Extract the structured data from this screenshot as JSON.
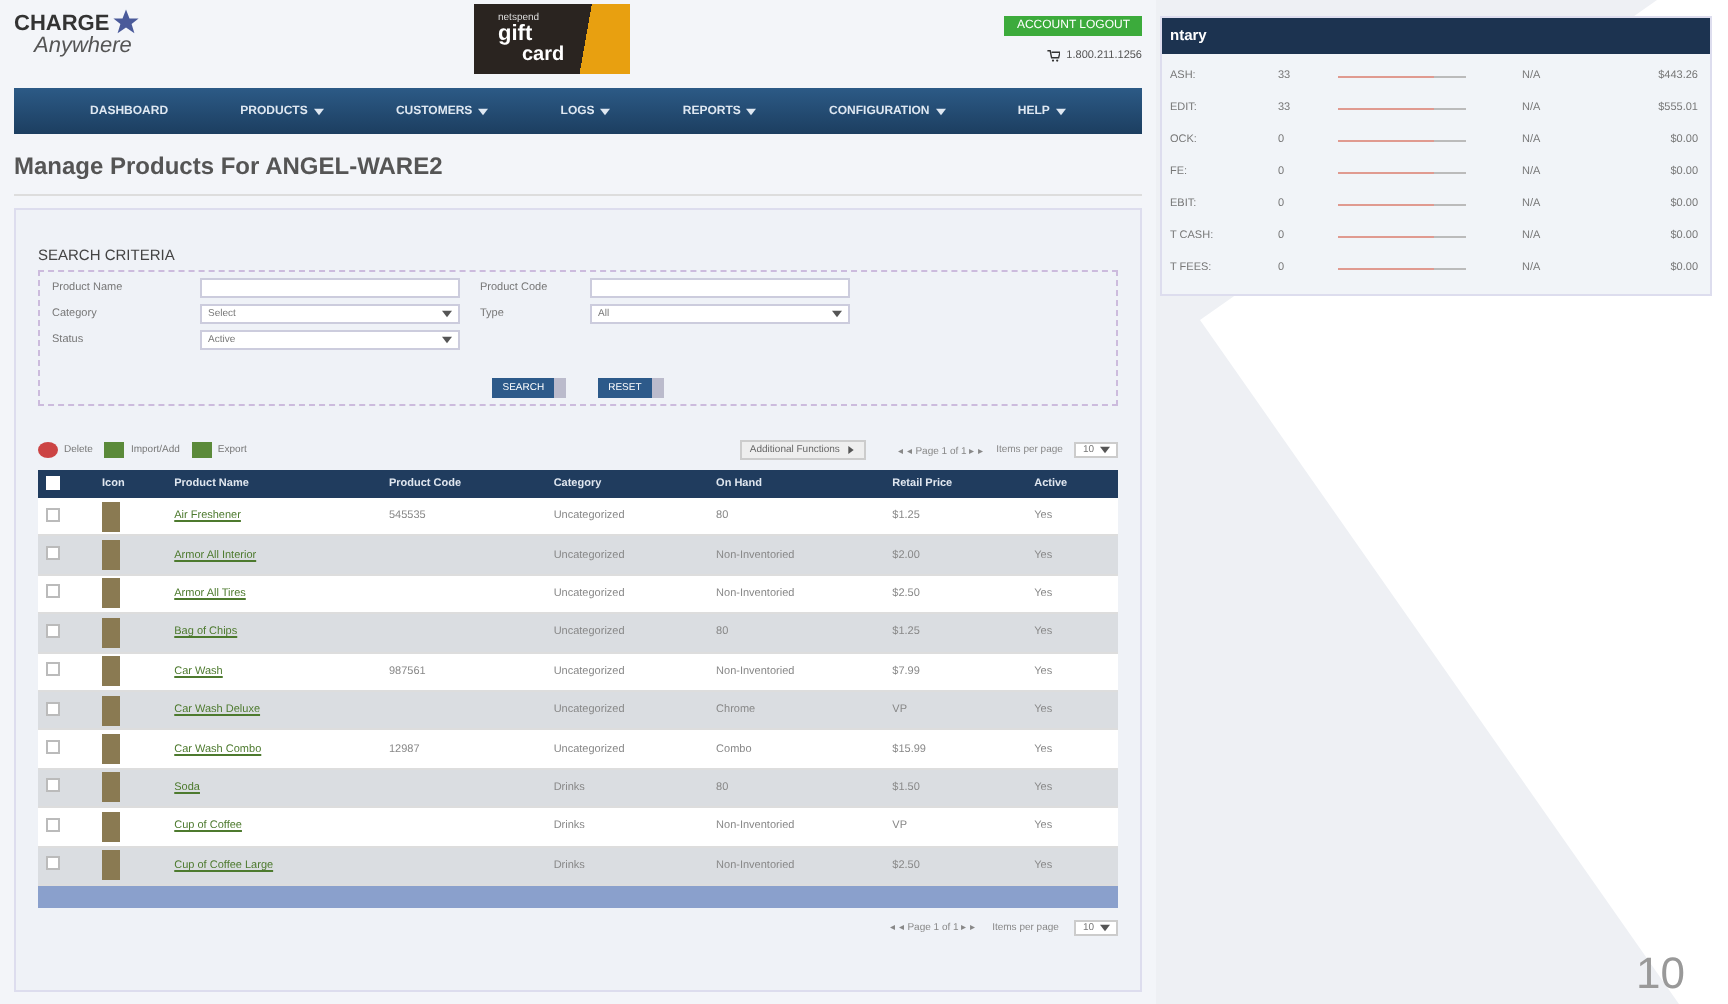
{
  "header": {
    "logo_top": "CHARGE",
    "logo_bottom": "Anywhere",
    "banner_small": "netspend",
    "banner_top": "gift",
    "banner_bottom": "card",
    "logout_button": "ACCOUNT LOGOUT",
    "phone": "1.800.211.1256"
  },
  "nav": [
    {
      "label": "DASHBOARD",
      "dropdown": false
    },
    {
      "label": "PRODUCTS",
      "dropdown": true
    },
    {
      "label": "CUSTOMERS",
      "dropdown": true
    },
    {
      "label": "LOGS",
      "dropdown": true
    },
    {
      "label": "REPORTS",
      "dropdown": true
    },
    {
      "label": "CONFIGURATION",
      "dropdown": true
    },
    {
      "label": "HELP",
      "dropdown": true
    }
  ],
  "page_title": "Manage Products For ANGEL-WARE2",
  "search": {
    "title": "SEARCH CRITERIA",
    "fields": [
      {
        "label": "Product Name",
        "kind": "text"
      },
      {
        "label": "Product Code",
        "kind": "text"
      },
      {
        "label": "Category",
        "kind": "select",
        "value": "Select"
      },
      {
        "label": "Type",
        "kind": "select",
        "value": "All"
      },
      {
        "label": "Status",
        "kind": "select",
        "value": "Active"
      }
    ],
    "buttons": [
      "SEARCH",
      "RESET"
    ]
  },
  "toolbar": {
    "actions": [
      "Delete",
      "Import/Add",
      "Export"
    ],
    "additional": "Additional Functions",
    "pager": "◂ ◂ Page 1 of 1 ▸ ▸",
    "per_page_label": "Items per page",
    "per_page": "10"
  },
  "table": {
    "all_checked": false,
    "columns": [
      "Icon",
      "Product Name",
      "Product Code",
      "Category",
      "On Hand",
      "Retail Price",
      "Active"
    ],
    "rows": [
      {
        "checked": false,
        "name": "Air Freshener",
        "code": "545535",
        "category": "Uncategorized",
        "on_hand": "80",
        "price": "$1.25",
        "active": "Yes"
      },
      {
        "checked": false,
        "name": "Armor All Interior",
        "code": "",
        "category": "Uncategorized",
        "on_hand": "Non-Inventoried",
        "price": "$2.00",
        "active": "Yes"
      },
      {
        "checked": false,
        "name": "Armor All Tires",
        "code": "",
        "category": "Uncategorized",
        "on_hand": "Non-Inventoried",
        "price": "$2.50",
        "active": "Yes"
      },
      {
        "checked": false,
        "name": "Bag of Chips",
        "code": "",
        "category": "Uncategorized",
        "on_hand": "80",
        "price": "$1.25",
        "active": "Yes"
      },
      {
        "checked": false,
        "name": "Car Wash",
        "code": "987561",
        "category": "Uncategorized",
        "on_hand": "Non-Inventoried",
        "price": "$7.99",
        "active": "Yes"
      },
      {
        "checked": false,
        "name": "Car Wash Deluxe",
        "code": "",
        "category": "Uncategorized",
        "on_hand": "Chrome",
        "price": "VP",
        "active": "Yes"
      },
      {
        "checked": false,
        "name": "Car Wash Combo",
        "code": "12987",
        "category": "Uncategorized",
        "on_hand": "Combo",
        "price": "$15.99",
        "active": "Yes"
      },
      {
        "checked": false,
        "name": "Soda",
        "code": "",
        "category": "Drinks",
        "on_hand": "80",
        "price": "$1.50",
        "active": "Yes"
      },
      {
        "checked": false,
        "name": "Cup of Coffee",
        "code": "",
        "category": "Drinks",
        "on_hand": "Non-Inventoried",
        "price": "VP",
        "active": "Yes"
      },
      {
        "checked": false,
        "name": "Cup of Coffee Large",
        "code": "",
        "category": "Drinks",
        "on_hand": "Non-Inventoried",
        "price": "$2.50",
        "active": "Yes"
      }
    ]
  },
  "bottom_pager": {
    "pager": "◂ ◂ Page 1 of 1 ▸ ▸",
    "per_page_label": "Items per page",
    "per_page": "10"
  },
  "summary": {
    "title": "ntary",
    "rows": [
      {
        "label": "ASH:",
        "count": "33",
        "level": 0.75,
        "period": "N/A",
        "amount": "$443.26"
      },
      {
        "label": "EDIT:",
        "count": "33",
        "level": 0.75,
        "period": "N/A",
        "amount": "$555.01"
      },
      {
        "label": "OCK:",
        "count": "0",
        "level": 0.75,
        "period": "N/A",
        "amount": "$0.00"
      },
      {
        "label": "FE:",
        "count": "0",
        "level": 0.75,
        "period": "N/A",
        "amount": "$0.00"
      },
      {
        "label": "EBIT:",
        "count": "0",
        "level": 0.75,
        "period": "N/A",
        "amount": "$0.00"
      },
      {
        "label": "T CASH:",
        "count": "0",
        "level": 0.75,
        "period": "N/A",
        "amount": "$0.00"
      },
      {
        "label": "T FEES:",
        "count": "0",
        "level": 0.75,
        "period": "N/A",
        "amount": "$0.00"
      }
    ]
  },
  "slide_number": "10"
}
